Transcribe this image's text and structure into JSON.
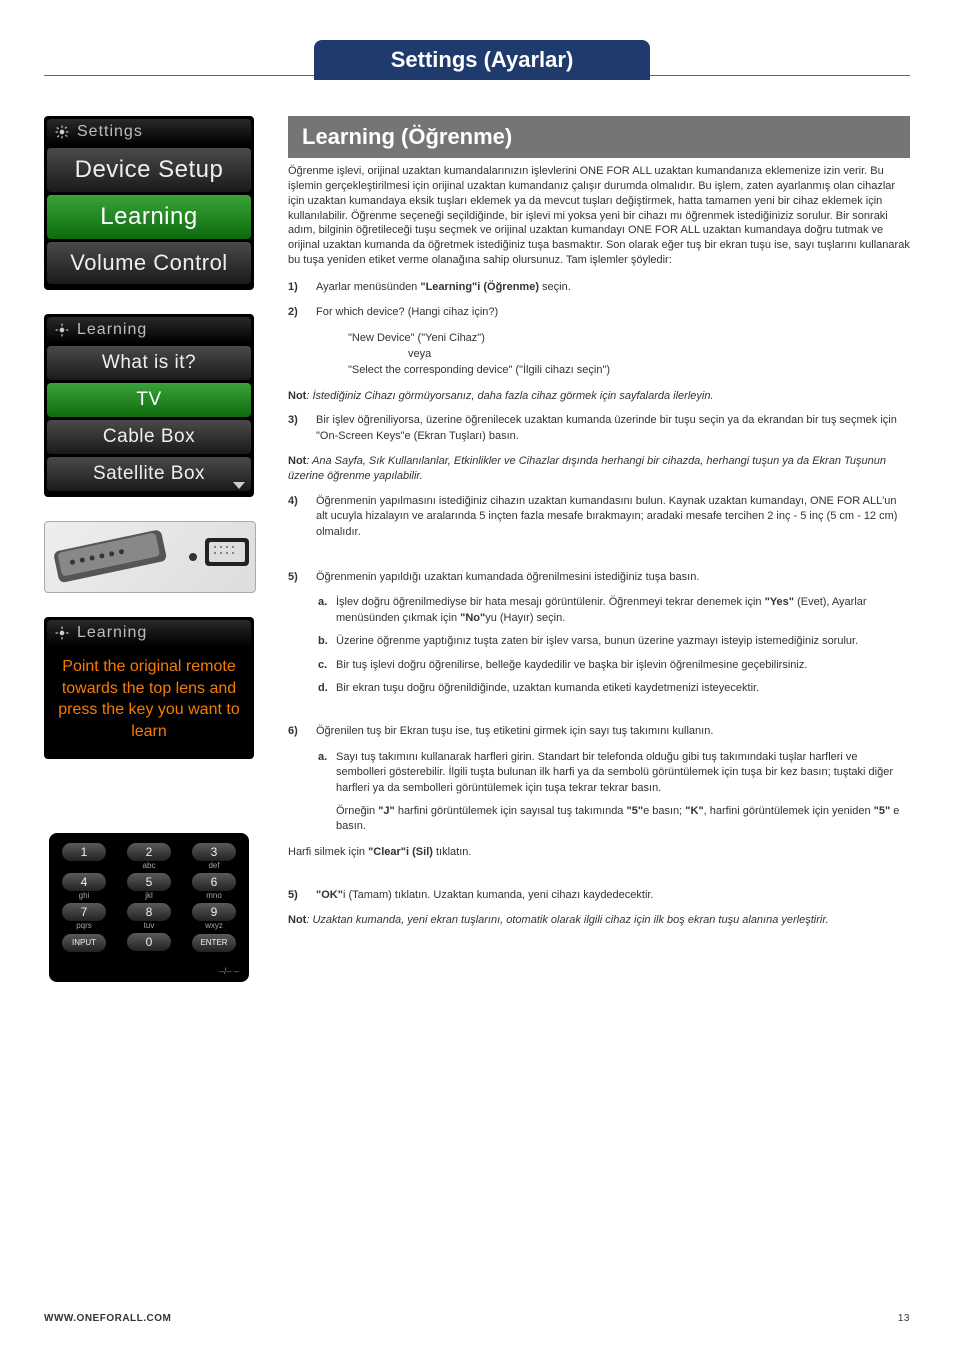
{
  "header": {
    "tab": "Settings (Ayarlar)"
  },
  "left": {
    "panel1": {
      "title": "Settings",
      "rows": [
        "Device Setup",
        "Learning",
        "Volume Control"
      ]
    },
    "panel2": {
      "title": "Learning",
      "rows": [
        "What is it?",
        "TV",
        "Cable Box",
        "Satellite Box"
      ]
    },
    "panel3": {
      "title": "Learning",
      "text": "Point the original remote towards the top lens and press the key you want to learn"
    },
    "keypad": {
      "rows": [
        [
          {
            "d": "1",
            "l": ""
          },
          {
            "d": "2",
            "l": "abc"
          },
          {
            "d": "3",
            "l": "def"
          }
        ],
        [
          {
            "d": "4",
            "l": "ghi"
          },
          {
            "d": "5",
            "l": "jkl"
          },
          {
            "d": "6",
            "l": "mno"
          }
        ],
        [
          {
            "d": "7",
            "l": "pqrs"
          },
          {
            "d": "8",
            "l": "tuv"
          },
          {
            "d": "9",
            "l": "wxyz"
          }
        ],
        [
          {
            "d": "INPUT",
            "l": ""
          },
          {
            "d": "0",
            "l": ""
          },
          {
            "d": "ENTER",
            "l": ""
          }
        ]
      ],
      "bottom": "–/– –"
    }
  },
  "right": {
    "title": "Learning (Öğrenme)",
    "intro": "Öğrenme işlevi, orijinal uzaktan kumandalarınızın işlevlerini ONE FOR ALL uzaktan kumandanıza eklemenize izin verir. Bu işlemin gerçekleştirilmesi için orijinal uzaktan kumandanız çalışır durumda olmalıdır. Bu işlem, zaten ayarlanmış olan cihazlar için uzaktan kumandaya eksik tuşları eklemek ya da mevcut tuşları değiştirmek, hatta tamamen yeni bir cihaz eklemek için kullanılabilir. Öğrenme seçeneği seçildiğinde, bir işlevi mi yoksa yeni bir cihazı mı öğrenmek istediğiniziz sorulur. Bir sonraki adım, bilginin öğretileceği tuşu seçmek ve orijinal uzaktan kumandayı ONE FOR ALL uzaktan kumandaya doğru tutmak ve orijinal uzaktan kumanda da öğretmek istediğiniz tuşa basmaktır. Son olarak eğer tuş bir ekran tuşu ise, sayı tuşlarını kullanarak bu tuşa yeniden etiket verme olanağına sahip olursunuz. Tam işlemler şöyledir:",
    "step1": {
      "n": "1)",
      "pre": "Ayarlar menüsünden ",
      "bold": "\"Learning\"i (Öğrenme)",
      "post": " seçin."
    },
    "step2": {
      "n": "2)",
      "text": "For which device? (Hangi cihaz için?)"
    },
    "step2_block": {
      "l1": "\"New Device\" (\"Yeni Cihaz\")",
      "l2": "veya",
      "l3": "\"Select the corresponding device\" (\"İlgili cihazı seçin\")"
    },
    "note1": {
      "b": "Not",
      "t": ": İstediğiniz Cihazı görmüyorsanız, daha fazla cihaz görmek için sayfalarda ilerleyin."
    },
    "step3": {
      "n": "3)",
      "text": "Bir işlev öğreniliyorsa, üzerine öğrenilecek uzaktan kumanda üzerinde bir tuşu seçin ya da ekrandan bir tuş seçmek için \"On-Screen Keys\"e (Ekran Tuşları) basın."
    },
    "note2": {
      "b": "Not",
      "t": ": Ana Sayfa, Sık Kullanılanlar, Etkinlikler ve Cihazlar dışında herhangi bir cihazda, herhangi tuşun ya da Ekran Tuşunun üzerine öğrenme yapılabilir."
    },
    "step4": {
      "n": "4)",
      "text": "Öğrenmenin yapılmasını istediğiniz cihazın uzaktan kumandasını bulun. Kaynak uzaktan kumandayı, ONE FOR ALL'un alt ucuyla hizalayın ve aralarında 5 inçten fazla mesafe bırakmayın; aradaki mesafe tercihen 2 inç - 5 inç (5 cm - 12 cm) olmalıdır."
    },
    "step5": {
      "n": "5)",
      "text": "Öğrenmenin yapıldığı uzaktan kumandada öğrenilmesini istediğiniz tuşa basın."
    },
    "sub_a": {
      "l": "a.",
      "pre": "İşlev doğru öğrenilmediyse bir hata mesajı görüntülenir. Öğrenmeyi tekrar denemek için ",
      "b1": "\"Yes\"",
      "mid": " (Evet), Ayarlar menüsünden çıkmak için ",
      "b2": "\"No\"",
      "post": "yu (Hayır) seçin."
    },
    "sub_b": {
      "l": "b.",
      "t": "Üzerine öğrenme yaptığınız tuşta zaten bir işlev varsa, bunun üzerine yazmayı isteyip istemediğiniz sorulur."
    },
    "sub_c": {
      "l": "c.",
      "t": "Bir tuş işlevi doğru öğrenilirse, belleğe kaydedilir ve başka bir işlevin öğrenilmesine geçebilirsiniz."
    },
    "sub_d": {
      "l": "d.",
      "t": "Bir ekran tuşu doğru öğrenildiğinde, uzaktan kumanda etiketi kaydetmenizi isteyecektir."
    },
    "step6": {
      "n": "6)",
      "text": "Öğrenilen tuş bir Ekran tuşu ise, tuş etiketini girmek için sayı tuş takımını kullanın."
    },
    "sub6a": {
      "l": "a.",
      "t": "Sayı tuş takımını kullanarak harfleri girin. Standart bir telefonda olduğu gibi tuş takımındaki tuşlar harfleri ve sembolleri gösterebilir. İlgili tuşta bulunan ilk harfi ya da sembolü görüntülemek için tuşa bir kez basın; tuştaki diğer harfleri ya da sembolleri görüntülemek için tuşa tekrar tekrar basın."
    },
    "example": {
      "p1": "Örneğin ",
      "b1": "\"J\"",
      "p2": " harfini görüntülemek için sayısal tuş takımında ",
      "b2": "\"5\"",
      "p3": "e basın; ",
      "b3": "\"K\"",
      "p4": ", harfini görüntülemek için yeniden ",
      "b4": "\"5\"",
      "p5": " e basın."
    },
    "clear": {
      "p": "Harfi silmek için ",
      "b": "\"Clear\"i (Sil)",
      "post": " tıklatın."
    },
    "step5b": {
      "n": "5)",
      "b": "\"OK\"",
      "post": "i (Tamam) tıklatın. Uzaktan kumanda, yeni cihazı kaydedecektir."
    },
    "note3": {
      "b": "Not",
      "t": ": Uzaktan kumanda, yeni ekran tuşlarını, otomatik olarak ilgili cihaz için ilk boş ekran tuşu alanına yerleştirir."
    }
  },
  "footer": {
    "url": "WWW.ONEFORALL.COM",
    "page": "13"
  }
}
